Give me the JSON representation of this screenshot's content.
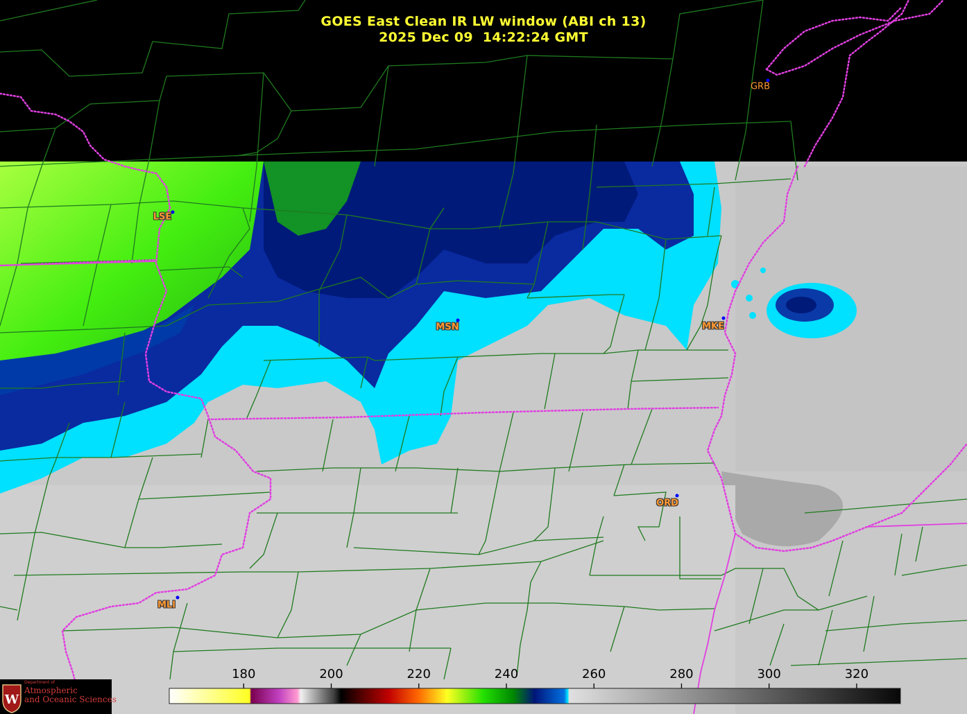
{
  "title": {
    "line1": "GOES East Clean IR LW window (ABI ch 13)",
    "line2": "2025 Dec 09  14:22:24 GMT"
  },
  "stations": [
    {
      "code": "GRB",
      "outlined": false
    },
    {
      "code": "LSE",
      "outlined": true
    },
    {
      "code": "MSN",
      "outlined": true
    },
    {
      "code": "MKE",
      "outlined": true
    },
    {
      "code": "ORD",
      "outlined": true
    },
    {
      "code": "MLI",
      "outlined": true
    }
  ],
  "colorbar": {
    "unit_values": [
      180,
      200,
      220,
      240,
      260,
      280,
      300,
      320
    ],
    "labels": [
      "180",
      "200",
      "220",
      "240",
      "260",
      "280",
      "300",
      "320"
    ],
    "range": [
      163,
      330
    ],
    "colors": {
      "warm_gray_light": "#d8d8d8",
      "warm_gray_dark": "#101010",
      "cyan": "#00e6ff",
      "navy": "#00157a",
      "green": "#22e000",
      "yellow": "#ffff22",
      "red": "#c00000",
      "magenta": "#c040c0"
    }
  },
  "colors": {
    "title": "#ffff33",
    "county_lines": "#1f7a1f",
    "state_borders": "#e040e0",
    "station_label": "#ff9933",
    "station_dot": "#0000ff"
  },
  "logo": {
    "small": "Department of",
    "line1": "Atmospheric",
    "line2": "and Oceanic Sciences",
    "badge": "W"
  }
}
